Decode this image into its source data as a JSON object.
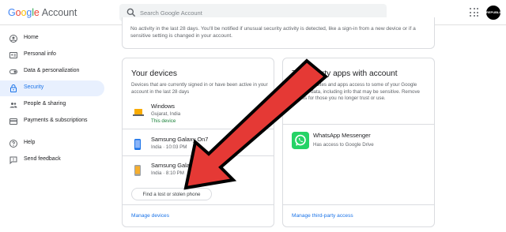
{
  "header": {
    "logo_letters": [
      "G",
      "o",
      "o",
      "g",
      "l",
      "e"
    ],
    "account_word": "Account",
    "search_placeholder": "Search Google Account",
    "avatar_text": "REPUBLIC WORLD"
  },
  "sidebar": {
    "items": [
      {
        "label": "Home",
        "icon": "home-icon",
        "active": false
      },
      {
        "label": "Personal info",
        "icon": "id-card-icon",
        "active": false
      },
      {
        "label": "Data & personalization",
        "icon": "toggle-icon",
        "active": false
      },
      {
        "label": "Security",
        "icon": "lock-icon",
        "active": true
      },
      {
        "label": "People & sharing",
        "icon": "people-icon",
        "active": false
      },
      {
        "label": "Payments & subscriptions",
        "icon": "credit-card-icon",
        "active": false
      },
      {
        "label": "Help",
        "icon": "help-icon",
        "active": false
      },
      {
        "label": "Send feedback",
        "icon": "feedback-icon",
        "active": false
      }
    ]
  },
  "security_notice": {
    "text": "No activity in the last 28 days. You'll be notified if unusual security activity is detected, like a sign-in from a new device or if a sensitive setting is changed in your account."
  },
  "devices": {
    "title": "Your devices",
    "description": "Devices that are currently signed in or have been active in your account in the last 28 days",
    "list": [
      {
        "name": "Windows",
        "detail": "Gujarat, India",
        "status": "This device",
        "icon": "laptop-icon"
      },
      {
        "name": "Samsung Galaxy On7",
        "detail": "India · 10:03 PM",
        "status": "",
        "icon": "phone-icon"
      },
      {
        "name": "Samsung Galaxy",
        "detail": "India · 8:10 PM",
        "status": "",
        "icon": "phone-icon"
      }
    ],
    "find_button": "Find a lost or stolen phone",
    "manage_link": "Manage devices"
  },
  "third_party": {
    "title_visible": "Third-party apps with account",
    "description": "Give these sites and apps access to some of your Google Account data, including info that may be sensitive. Remove access for those you no longer trust or use.",
    "app": {
      "name": "WhatsApp Messenger",
      "access": "Has access to Google Drive",
      "icon": "whatsapp-icon"
    },
    "manage_link": "Manage third-party access"
  },
  "colors": {
    "accent": "#1a73e8",
    "active_bg": "#e8f0fe",
    "green": "#188038",
    "arrow_red": "#e53935",
    "whatsapp": "#25d366"
  }
}
